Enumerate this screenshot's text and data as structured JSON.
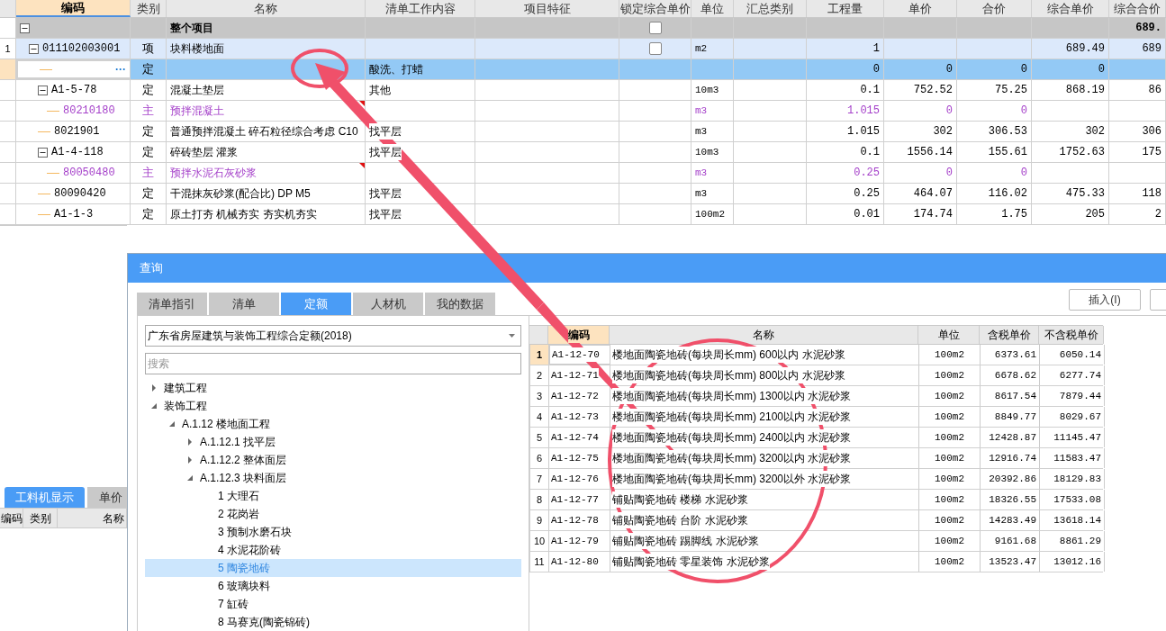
{
  "grid": {
    "columns": [
      {
        "label": "编码",
        "selected": true
      },
      {
        "label": "类别",
        "selected": false
      },
      {
        "label": "名称",
        "selected": false
      },
      {
        "label": "清单工作内容",
        "selected": false
      },
      {
        "label": "项目特征",
        "selected": false
      },
      {
        "label": "锁定综合单价",
        "selected": false
      },
      {
        "label": "单位",
        "selected": false
      },
      {
        "label": "汇总类别",
        "selected": false
      },
      {
        "label": "工程量",
        "selected": false
      },
      {
        "label": "单价",
        "selected": false
      },
      {
        "label": "合价",
        "selected": false
      },
      {
        "label": "综合单价",
        "selected": false
      },
      {
        "label": "综合合价",
        "selected": false
      }
    ],
    "rows": [
      {
        "kind": "project",
        "name": "整个项目",
        "locked": false,
        "comp_total": "689.",
        "expanded": true,
        "selected": false,
        "children": [
          {
            "kind": "item",
            "no": "1",
            "code": "011102003001",
            "type": "项",
            "name": "块料楼地面",
            "locked": false,
            "unit": "m2",
            "qty": "1",
            "comp_price": "689.49",
            "comp_total": "689",
            "expanded": true,
            "selected": false,
            "children": [
              {
                "kind": "quota",
                "type": "定",
                "content": "酸洗、打蜡",
                "qty": "0",
                "price": "0",
                "total": "0",
                "comp_price": "0",
                "button": "···",
                "selected": true
              },
              {
                "kind": "quota",
                "code": "A1-5-78",
                "type": "定",
                "name": "混凝土垫层",
                "content": "其他",
                "unit": "10m3",
                "qty": "0.1",
                "price": "752.52",
                "total": "75.25",
                "comp_price": "868.19",
                "comp_total": "86",
                "expanded": true,
                "selected": false,
                "children": [
                  {
                    "kind": "material",
                    "code": "80210180",
                    "type": "主",
                    "name": "预拌混凝土",
                    "unit": "m3",
                    "qty": "1.015",
                    "price": "0",
                    "total": "0",
                    "selected": false
                  }
                ]
              },
              {
                "kind": "quota",
                "code": "8021901",
                "type": "定",
                "name": "普通预拌混凝土 碎石粒径综合考虑 C10",
                "content": "找平层",
                "unit": "m3",
                "qty": "1.015",
                "price": "302",
                "total": "306.53",
                "comp_price": "302",
                "comp_total": "306",
                "selected": false
              },
              {
                "kind": "quota",
                "code": "A1-4-118",
                "type": "定",
                "name": "碎砖垫层 灌浆",
                "content": "找平层",
                "unit": "10m3",
                "qty": "0.1",
                "price": "1556.14",
                "total": "155.61",
                "comp_price": "1752.63",
                "comp_total": "175",
                "expanded": true,
                "selected": false,
                "children": [
                  {
                    "kind": "material",
                    "code": "80050480",
                    "type": "主",
                    "name": "预拌水泥石灰砂浆",
                    "unit": "m3",
                    "qty": "0.25",
                    "price": "0",
                    "total": "0",
                    "selected": false
                  }
                ]
              },
              {
                "kind": "quota",
                "code": "80090420",
                "type": "定",
                "name": "干混抹灰砂浆(配合比) DP M5",
                "content": "找平层",
                "unit": "m3",
                "qty": "0.25",
                "price": "464.07",
                "total": "116.02",
                "comp_price": "475.33",
                "comp_total": "118",
                "selected": false
              },
              {
                "kind": "quota",
                "code": "A1-1-3",
                "type": "定",
                "name": "原土打夯 机械夯实 夯实机夯实",
                "content": "找平层",
                "unit": "100m2",
                "qty": "0.01",
                "price": "174.74",
                "total": "1.75",
                "comp_price": "205",
                "comp_total": "2",
                "selected": false
              }
            ]
          }
        ]
      }
    ]
  },
  "bottom_panel": {
    "tabs": [
      {
        "label": "工料机显示",
        "selected": true
      },
      {
        "label": "单价",
        "selected": false
      }
    ],
    "columns": [
      "编码",
      "类别",
      "名称"
    ]
  },
  "dialog": {
    "title": "查询",
    "tabs": [
      {
        "label": "清单指引",
        "selected": false
      },
      {
        "label": "清单",
        "selected": false
      },
      {
        "label": "定额",
        "selected": true
      },
      {
        "label": "人材机",
        "selected": false
      },
      {
        "label": "我的数据",
        "selected": false
      }
    ],
    "insert_button": "插入(I)",
    "library": "广东省房屋建筑与装饰工程综合定额(2018)",
    "search": {
      "placeholder": "搜索"
    },
    "tree": [
      {
        "label": "建筑工程",
        "expanded": false,
        "selected": false
      },
      {
        "label": "装饰工程",
        "expanded": true,
        "selected": false,
        "children": [
          {
            "label": "A.1.12 楼地面工程",
            "expanded": true,
            "selected": false,
            "children": [
              {
                "label": "A.1.12.1 找平层",
                "expanded": false,
                "selected": false
              },
              {
                "label": "A.1.12.2 整体面层",
                "expanded": false,
                "selected": false
              },
              {
                "label": "A.1.12.3 块料面层",
                "expanded": true,
                "selected": false,
                "children": [
                  {
                    "label": "1 大理石",
                    "selected": false
                  },
                  {
                    "label": "2 花岗岩",
                    "selected": false
                  },
                  {
                    "label": "3 预制水磨石块",
                    "selected": false
                  },
                  {
                    "label": "4 水泥花阶砖",
                    "selected": false
                  },
                  {
                    "label": "5 陶瓷地砖",
                    "selected": true
                  },
                  {
                    "label": "6 玻璃块料",
                    "selected": false
                  },
                  {
                    "label": "7 缸砖",
                    "selected": false
                  },
                  {
                    "label": "8 马赛克(陶瓷锦砖)",
                    "selected": false
                  }
                ]
              }
            ]
          }
        ]
      }
    ],
    "table": {
      "columns": [
        {
          "label": "编码",
          "selected": true
        },
        {
          "label": "名称",
          "selected": false
        },
        {
          "label": "单位",
          "selected": false
        },
        {
          "label": "含税单价",
          "selected": false
        },
        {
          "label": "不含税单价",
          "selected": false
        }
      ],
      "rows": [
        {
          "no": "1",
          "code": "A1-12-70",
          "name": "楼地面陶瓷地砖(每块周长mm) 600以内 水泥砂浆",
          "unit": "100m2",
          "tax_price": "6373.61",
          "net_price": "6050.14",
          "selected": true
        },
        {
          "no": "2",
          "code": "A1-12-71",
          "name": "楼地面陶瓷地砖(每块周长mm) 800以内 水泥砂浆",
          "unit": "100m2",
          "tax_price": "6678.62",
          "net_price": "6277.74",
          "selected": false
        },
        {
          "no": "3",
          "code": "A1-12-72",
          "name": "楼地面陶瓷地砖(每块周长mm) 1300以内 水泥砂浆",
          "unit": "100m2",
          "tax_price": "8617.54",
          "net_price": "7879.44",
          "selected": false
        },
        {
          "no": "4",
          "code": "A1-12-73",
          "name": "楼地面陶瓷地砖(每块周长mm) 2100以内 水泥砂浆",
          "unit": "100m2",
          "tax_price": "8849.77",
          "net_price": "8029.67",
          "selected": false
        },
        {
          "no": "5",
          "code": "A1-12-74",
          "name": "楼地面陶瓷地砖(每块周长mm) 2400以内 水泥砂浆",
          "unit": "100m2",
          "tax_price": "12428.87",
          "net_price": "11145.47",
          "selected": false
        },
        {
          "no": "6",
          "code": "A1-12-75",
          "name": "楼地面陶瓷地砖(每块周长mm) 3200以内 水泥砂浆",
          "unit": "100m2",
          "tax_price": "12916.74",
          "net_price": "11583.47",
          "selected": false
        },
        {
          "no": "7",
          "code": "A1-12-76",
          "name": "楼地面陶瓷地砖(每块周长mm) 3200以外 水泥砂浆",
          "unit": "100m2",
          "tax_price": "20392.86",
          "net_price": "18129.83",
          "selected": false
        },
        {
          "no": "8",
          "code": "A1-12-77",
          "name": "铺贴陶瓷地砖 楼梯 水泥砂浆",
          "unit": "100m2",
          "tax_price": "18326.55",
          "net_price": "17533.08",
          "selected": false
        },
        {
          "no": "9",
          "code": "A1-12-78",
          "name": "铺贴陶瓷地砖 台阶 水泥砂浆",
          "unit": "100m2",
          "tax_price": "14283.49",
          "net_price": "13618.14",
          "selected": false
        },
        {
          "no": "10",
          "code": "A1-12-79",
          "name": "铺贴陶瓷地砖 踢脚线 水泥砂浆",
          "unit": "100m2",
          "tax_price": "9161.68",
          "net_price": "8861.29",
          "selected": false
        },
        {
          "no": "11",
          "code": "A1-12-80",
          "name": "铺贴陶瓷地砖 零星装饰 水泥砂浆",
          "unit": "100m2",
          "tax_price": "13523.47",
          "net_price": "13012.16",
          "selected": false
        }
      ]
    }
  }
}
